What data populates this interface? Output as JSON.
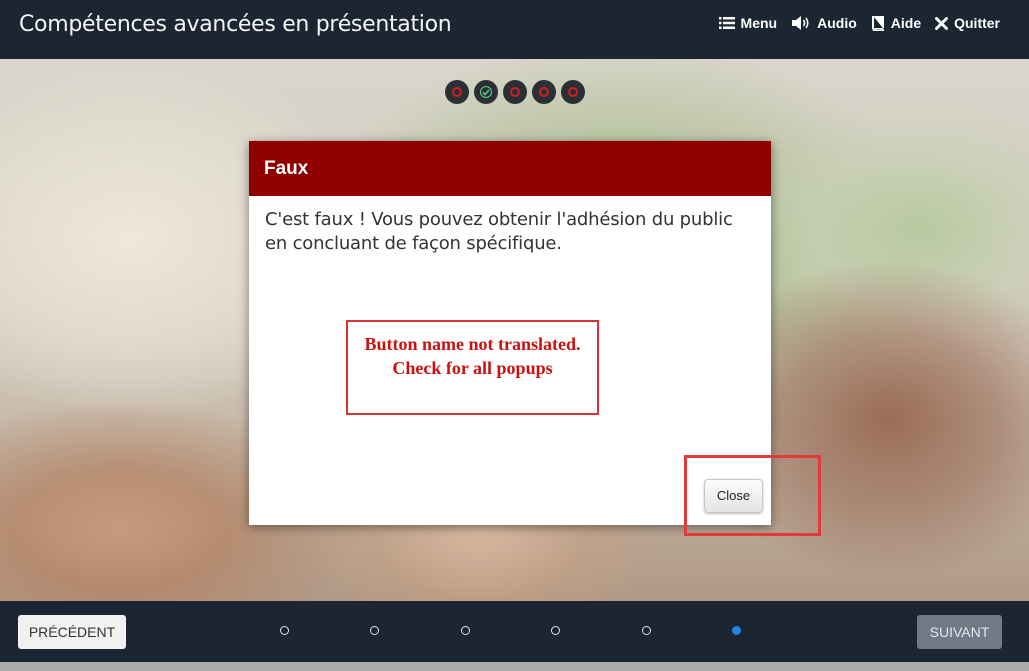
{
  "header": {
    "title": "Compétences avancées en présentation",
    "nav": [
      {
        "label": "Menu",
        "icon": "list-icon"
      },
      {
        "label": "Audio",
        "icon": "speaker-icon"
      },
      {
        "label": "Aide",
        "icon": "book-icon"
      },
      {
        "label": "Quitter",
        "icon": "close-icon"
      }
    ]
  },
  "progress": [
    {
      "state": "incorrect"
    },
    {
      "state": "correct"
    },
    {
      "state": "incorrect"
    },
    {
      "state": "incorrect"
    },
    {
      "state": "incorrect"
    }
  ],
  "dialog": {
    "title": "Faux",
    "message": "C'est faux ! Vous pouvez obtenir l'adhésion du public en concluant de façon spécifique.",
    "close_label": "Close"
  },
  "annotation": {
    "text": "Button name not translated. Check for all popups"
  },
  "footer": {
    "prev_label": "PRÉCÉDENT",
    "next_label": "SUIVANT",
    "slide_count": 6,
    "active_slide": 6
  },
  "colors": {
    "bar": "#1c2532",
    "dialog_header": "#8e0000",
    "annotation": "#d63333",
    "active_dot": "#1f86ea"
  }
}
